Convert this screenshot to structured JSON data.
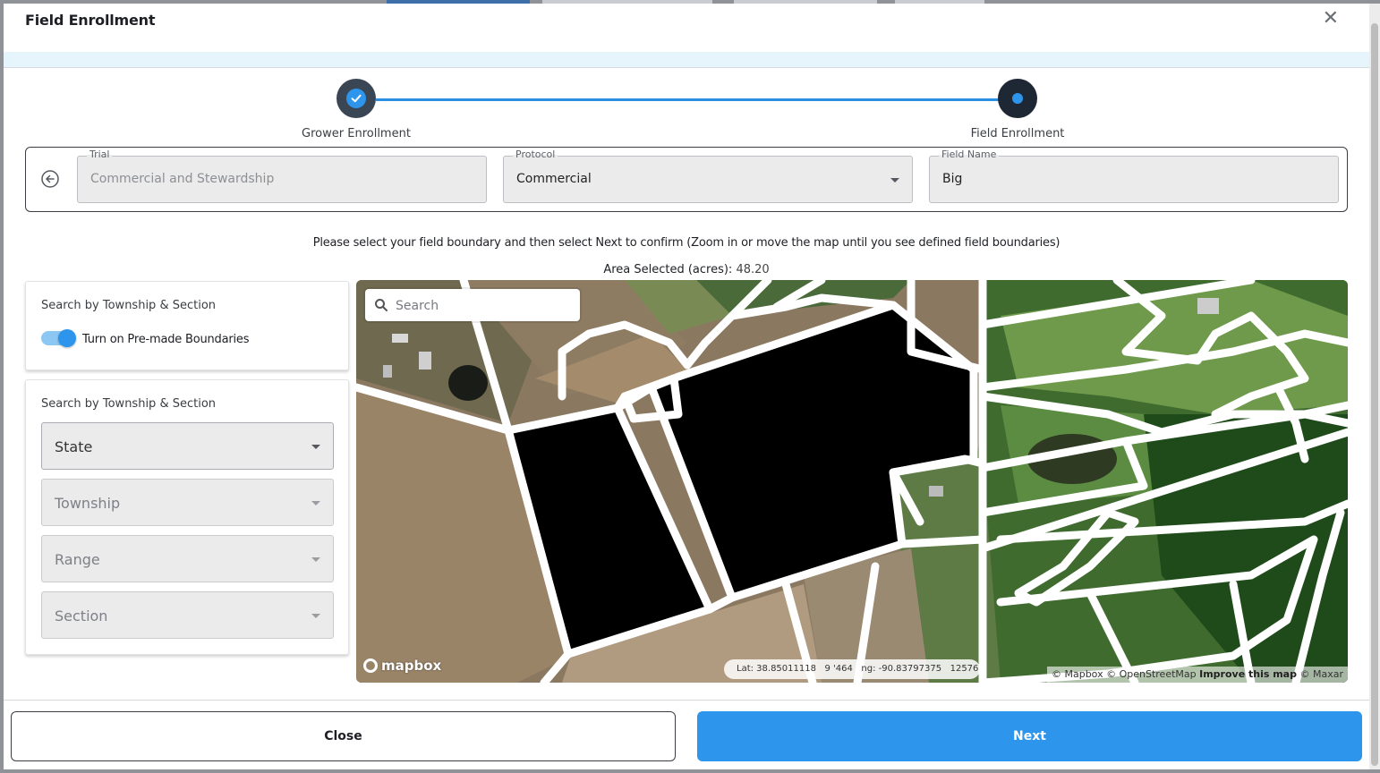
{
  "modal": {
    "title": "Field Enrollment",
    "close_icon": "close-icon"
  },
  "stepper": {
    "steps": [
      {
        "label": "Grower Enrollment",
        "status": "completed"
      },
      {
        "label": "Field Enrollment",
        "status": "current"
      }
    ]
  },
  "form": {
    "trial": {
      "label": "Trial",
      "value": "Commercial and Stewardship"
    },
    "protocol": {
      "label": "Protocol",
      "value": "Commercial"
    },
    "field_name": {
      "label": "Field Name",
      "value": "Big"
    }
  },
  "instructions": "Please select your field boundary and then select Next to confirm (Zoom in or move the map until you see defined field boundaries)",
  "area": {
    "label": "Area Selected (acres):",
    "value": "48.20"
  },
  "boundaries_panel": {
    "title": "Search by Township & Section",
    "toggle_label": "Turn on Pre-made Boundaries",
    "toggle_on": true
  },
  "township_panel": {
    "title": "Search by Township & Section",
    "selects": [
      {
        "value": "State",
        "disabled": false
      },
      {
        "value": "Township",
        "disabled": true
      },
      {
        "value": "Range",
        "disabled": true
      },
      {
        "value": "Section",
        "disabled": true
      }
    ]
  },
  "map": {
    "search_placeholder": "Search",
    "logo": "mapbox",
    "coords": "Lat: 38.85011118   9 '464   ng: -90.83797375   12576",
    "attribution": {
      "mapbox": "© Mapbox",
      "osm": "© OpenStreetMap",
      "improve": "Improve this map",
      "maxar": "© Maxar"
    }
  },
  "footer": {
    "close_label": "Close",
    "next_label": "Next"
  },
  "colors": {
    "accent": "#2d95ec",
    "selected_field": "#000000",
    "boundary": "#ffffff"
  }
}
